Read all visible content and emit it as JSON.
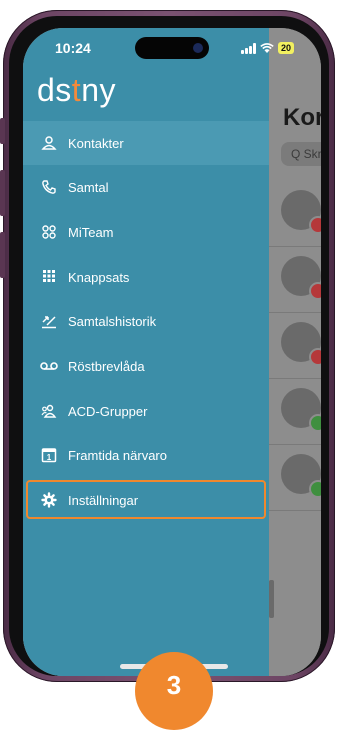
{
  "status_bar": {
    "time": "10:24",
    "battery": "20"
  },
  "logo": {
    "part1": "ds",
    "dot": "t",
    "part2": "ny"
  },
  "background": {
    "title": "Kor",
    "search_placeholder": "Q Skr"
  },
  "menu": {
    "items": [
      {
        "label": "Kontakter",
        "icon": "contacts-icon",
        "selected": true
      },
      {
        "label": "Samtal",
        "icon": "phone-icon"
      },
      {
        "label": "MiTeam",
        "icon": "team-icon"
      },
      {
        "label": "Knappsats",
        "icon": "keypad-icon"
      },
      {
        "label": "Samtalshistorik",
        "icon": "call-history-icon"
      },
      {
        "label": "Röstbrevlåda",
        "icon": "voicemail-icon"
      },
      {
        "label": "ACD-Grupper",
        "icon": "acd-groups-icon"
      },
      {
        "label": "Framtida närvaro",
        "icon": "calendar-icon"
      },
      {
        "label": "Inställningar",
        "icon": "gear-icon",
        "highlighted": true
      }
    ]
  },
  "annotation": {
    "step": "3"
  },
  "colors": {
    "drawer": "#3c8ea8",
    "selected": "#4b9ab3",
    "accent": "#f0882e",
    "frame": "#6d4564"
  }
}
